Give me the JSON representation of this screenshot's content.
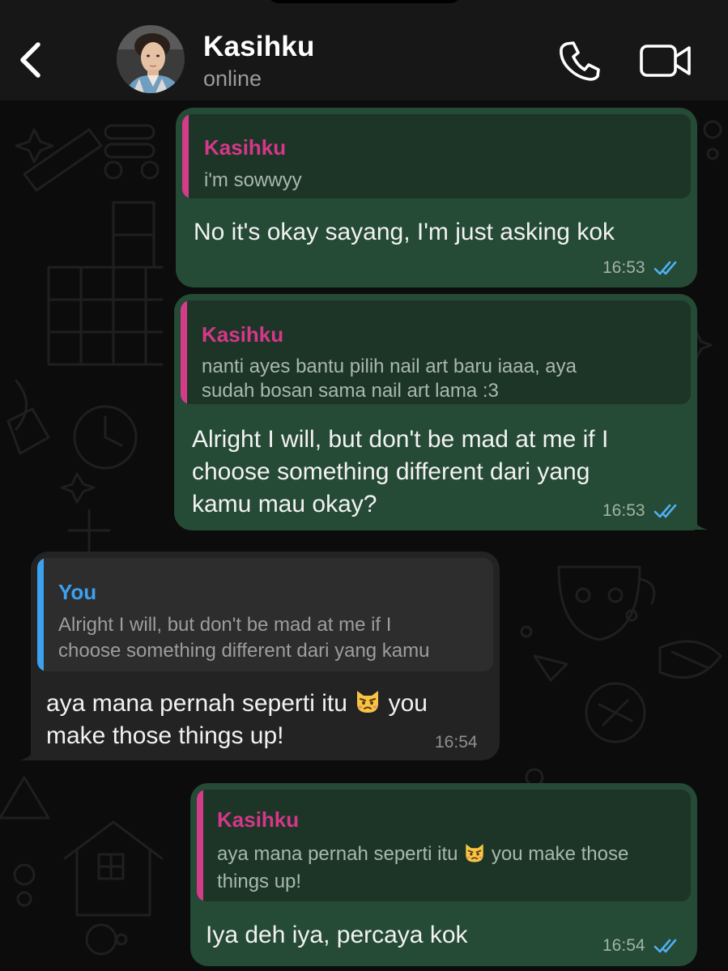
{
  "header": {
    "contact_name": "Kasihku",
    "status": "online",
    "back_icon": "chevron-left-icon",
    "call_icon": "phone-icon",
    "video_icon": "video-camera-icon"
  },
  "colors": {
    "outgoing_bubble": "#254a35",
    "incoming_bubble": "#232323",
    "quote_accent_contact": "#d6378a",
    "quote_accent_you": "#3ba1f0",
    "read_ticks": "#4fb0f5"
  },
  "messages": [
    {
      "direction": "outgoing",
      "quote_author": "Kasihku",
      "quote_text": "i'm sowwyy",
      "text": "No it's okay sayang, I'm just asking kok",
      "time": "16:53",
      "status": "read"
    },
    {
      "direction": "outgoing",
      "quote_author": "Kasihku",
      "quote_line1": "nanti ayes bantu pilih nail art baru iaaa, aya",
      "quote_line2": "sudah bosan sama nail art lama :3",
      "line1": "Alright I will, but don't be mad at me if I",
      "line2": "choose something different dari yang",
      "line3": "kamu mau okay?",
      "time": "16:53",
      "status": "read"
    },
    {
      "direction": "incoming",
      "quote_author": "You",
      "quote_line1": "Alright I will, but don't be mad at me if I",
      "quote_line2": "choose something different dari yang kamu",
      "line1_a": "aya mana pernah seperti itu",
      "line1_b": "you",
      "line2": "make those things up!",
      "emoji": "pouting-cat-emoji",
      "time": "16:54"
    },
    {
      "direction": "outgoing",
      "quote_author": "Kasihku",
      "quote_line1_a": "aya mana pernah seperti itu",
      "quote_line1_b": "you make those",
      "quote_line2": "things up!",
      "emoji": "pouting-cat-emoji",
      "text": "Iya deh iya, percaya kok",
      "time": "16:54",
      "status": "read"
    }
  ]
}
